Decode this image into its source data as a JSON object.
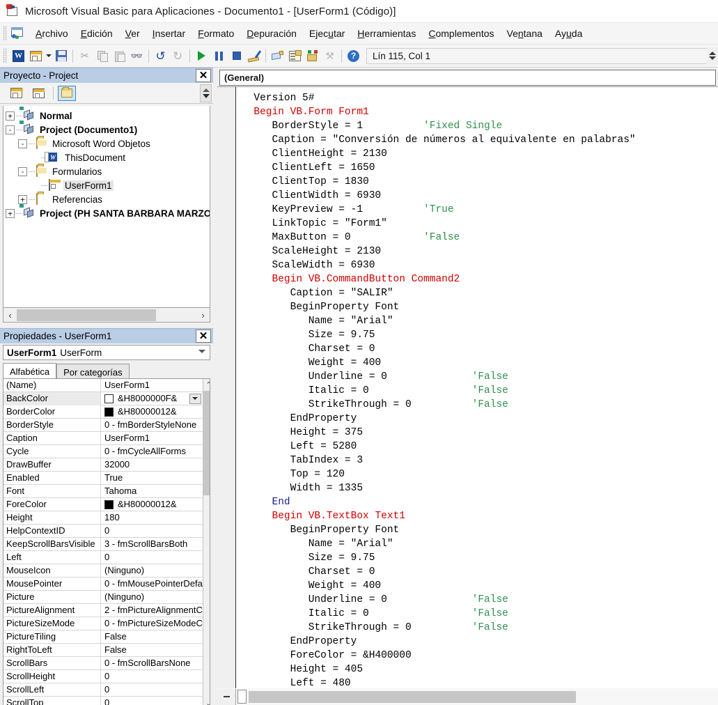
{
  "window": {
    "title": "Microsoft Visual Basic para Aplicaciones - Documento1 - [UserForm1 (Código)]",
    "app_icon": "vba-document-icon"
  },
  "menu": {
    "items": [
      {
        "pre": "",
        "accel": "A",
        "post": "rchivo"
      },
      {
        "pre": "",
        "accel": "E",
        "post": "dición"
      },
      {
        "pre": "",
        "accel": "V",
        "post": "er"
      },
      {
        "pre": "",
        "accel": "I",
        "post": "nsertar"
      },
      {
        "pre": "",
        "accel": "F",
        "post": "ormato"
      },
      {
        "pre": "",
        "accel": "D",
        "post": "epuración"
      },
      {
        "pre": "Ejec",
        "accel": "u",
        "post": "tar"
      },
      {
        "pre": "",
        "accel": "H",
        "post": "erramientas"
      },
      {
        "pre": "",
        "accel": "C",
        "post": "omplementos"
      },
      {
        "pre": "Ve",
        "accel": "n",
        "post": "tana"
      },
      {
        "pre": "Ay",
        "accel": "u",
        "post": "da"
      }
    ]
  },
  "toolbar": {
    "buttons": [
      {
        "name": "view-word-icon",
        "label": "Ver Microsoft Word",
        "enabled": true
      },
      {
        "name": "insert-userform-icon",
        "label": "Insertar UserForm",
        "enabled": true
      },
      {
        "name": "save-icon",
        "label": "Guardar Documento1",
        "enabled": true
      },
      {
        "name": "cut-icon",
        "label": "Cortar",
        "enabled": false
      },
      {
        "name": "copy-icon",
        "label": "Copiar",
        "enabled": false
      },
      {
        "name": "paste-icon",
        "label": "Pegar",
        "enabled": false
      },
      {
        "name": "find-icon",
        "label": "Buscar",
        "enabled": true
      },
      {
        "name": "undo-icon",
        "label": "Deshacer",
        "enabled": true
      },
      {
        "name": "redo-icon",
        "label": "Rehacer",
        "enabled": false
      },
      {
        "name": "run-icon",
        "label": "Ejecutar",
        "enabled": true
      },
      {
        "name": "pause-icon",
        "label": "Interrumpir",
        "enabled": true
      },
      {
        "name": "stop-icon",
        "label": "Restablecer",
        "enabled": true
      },
      {
        "name": "design-mode-icon",
        "label": "Modo de diseño",
        "enabled": true
      },
      {
        "name": "project-explorer-icon",
        "label": "Explorador de proyectos",
        "enabled": true
      },
      {
        "name": "properties-window-icon",
        "label": "Ventana Propiedades",
        "enabled": true
      },
      {
        "name": "object-browser-icon",
        "label": "Examinador de objetos",
        "enabled": true
      },
      {
        "name": "toolbox-icon",
        "label": "Cuadro de herramientas",
        "enabled": false
      },
      {
        "name": "help-icon",
        "label": "Ayuda",
        "enabled": true
      }
    ],
    "status": "Lín 115, Col 1"
  },
  "project_panel": {
    "title": "Proyecto - Project",
    "close_label": "✕",
    "toolbar": [
      {
        "name": "view-code-icon",
        "label": "Ver código",
        "selected": false
      },
      {
        "name": "view-object-icon",
        "label": "Ver objeto",
        "selected": false
      },
      {
        "name": "toggle-folders-icon",
        "label": "Alternar carpetas",
        "selected": true
      }
    ],
    "tree": [
      {
        "label": "Normal",
        "indent": 0,
        "toggle": "+",
        "icon": "vba-project-icon",
        "bold": true,
        "selected": false
      },
      {
        "label": "Project (Documento1)",
        "indent": 0,
        "toggle": "-",
        "icon": "vba-project-icon",
        "bold": true,
        "selected": false
      },
      {
        "label": "Microsoft Word Objetos",
        "indent": 1,
        "toggle": "-",
        "icon": "folder-open-icon",
        "bold": false,
        "selected": false
      },
      {
        "label": "ThisDocument",
        "indent": 2,
        "toggle": "",
        "icon": "word-document-icon",
        "bold": false,
        "selected": false
      },
      {
        "label": "Formularios",
        "indent": 1,
        "toggle": "-",
        "icon": "folder-open-icon",
        "bold": false,
        "selected": false
      },
      {
        "label": "UserForm1",
        "indent": 2,
        "toggle": "",
        "icon": "userform-icon",
        "bold": false,
        "selected": true
      },
      {
        "label": "Referencias",
        "indent": 1,
        "toggle": "+",
        "icon": "folder-icon",
        "bold": false,
        "selected": false
      },
      {
        "label": "Project (PH SANTA BARBARA MARZO",
        "indent": 0,
        "toggle": "+",
        "icon": "vba-project-icon",
        "bold": true,
        "selected": false
      }
    ],
    "scroll_left_arrow": "‹",
    "scroll_right_arrow": "›"
  },
  "properties_panel": {
    "title": "Propiedades - UserForm1",
    "close_label": "✕",
    "object_name": "UserForm1",
    "object_type": "UserForm",
    "tabs": [
      {
        "label": "Alfabética",
        "active": true
      },
      {
        "label": "Por categorías",
        "active": false
      }
    ],
    "rows": [
      {
        "name": "(Name)",
        "value": "UserForm1",
        "swatch": "",
        "dropdown": false,
        "selected": false
      },
      {
        "name": "BackColor",
        "value": "&H8000000F&",
        "swatch": "#ffffff",
        "dropdown": true,
        "selected": true
      },
      {
        "name": "BorderColor",
        "value": "&H80000012&",
        "swatch": "#000000",
        "dropdown": false,
        "selected": false
      },
      {
        "name": "BorderStyle",
        "value": "0 - fmBorderStyleNone",
        "swatch": "",
        "dropdown": false,
        "selected": false
      },
      {
        "name": "Caption",
        "value": "UserForm1",
        "swatch": "",
        "dropdown": false,
        "selected": false
      },
      {
        "name": "Cycle",
        "value": "0 - fmCycleAllForms",
        "swatch": "",
        "dropdown": false,
        "selected": false
      },
      {
        "name": "DrawBuffer",
        "value": "32000",
        "swatch": "",
        "dropdown": false,
        "selected": false
      },
      {
        "name": "Enabled",
        "value": "True",
        "swatch": "",
        "dropdown": false,
        "selected": false
      },
      {
        "name": "Font",
        "value": "Tahoma",
        "swatch": "",
        "dropdown": false,
        "selected": false
      },
      {
        "name": "ForeColor",
        "value": "&H80000012&",
        "swatch": "#000000",
        "dropdown": false,
        "selected": false
      },
      {
        "name": "Height",
        "value": "180",
        "swatch": "",
        "dropdown": false,
        "selected": false
      },
      {
        "name": "HelpContextID",
        "value": "0",
        "swatch": "",
        "dropdown": false,
        "selected": false
      },
      {
        "name": "KeepScrollBarsVisible",
        "value": "3 - fmScrollBarsBoth",
        "swatch": "",
        "dropdown": false,
        "selected": false
      },
      {
        "name": "Left",
        "value": "0",
        "swatch": "",
        "dropdown": false,
        "selected": false
      },
      {
        "name": "MouseIcon",
        "value": "(Ninguno)",
        "swatch": "",
        "dropdown": false,
        "selected": false
      },
      {
        "name": "MousePointer",
        "value": "0 - fmMousePointerDefa",
        "swatch": "",
        "dropdown": false,
        "selected": false
      },
      {
        "name": "Picture",
        "value": "(Ninguno)",
        "swatch": "",
        "dropdown": false,
        "selected": false
      },
      {
        "name": "PictureAlignment",
        "value": "2 - fmPictureAlignmentC",
        "swatch": "",
        "dropdown": false,
        "selected": false
      },
      {
        "name": "PictureSizeMode",
        "value": "0 - fmPictureSizeModeC",
        "swatch": "",
        "dropdown": false,
        "selected": false
      },
      {
        "name": "PictureTiling",
        "value": "False",
        "swatch": "",
        "dropdown": false,
        "selected": false
      },
      {
        "name": "RightToLeft",
        "value": "False",
        "swatch": "",
        "dropdown": false,
        "selected": false
      },
      {
        "name": "ScrollBars",
        "value": "0 - fmScrollBarsNone",
        "swatch": "",
        "dropdown": false,
        "selected": false
      },
      {
        "name": "ScrollHeight",
        "value": "0",
        "swatch": "",
        "dropdown": false,
        "selected": false
      },
      {
        "name": "ScrollLeft",
        "value": "0",
        "swatch": "",
        "dropdown": false,
        "selected": false
      },
      {
        "name": "ScrollTop",
        "value": "0",
        "swatch": "",
        "dropdown": false,
        "selected": false
      }
    ]
  },
  "code_pane": {
    "procedure_selector": "(General)",
    "lines": [
      [
        {
          "t": "  Version 5#",
          "c": ""
        }
      ],
      [
        {
          "t": "  ",
          "c": ""
        },
        {
          "t": "Begin VB.Form Form1",
          "c": "kw"
        }
      ],
      [
        {
          "t": "     BorderStyle = 1          ",
          "c": ""
        },
        {
          "t": "'Fixed Single",
          "c": "cm"
        }
      ],
      [
        {
          "t": "     Caption = \"Conversión de números al equivalente en palabras\"",
          "c": ""
        }
      ],
      [
        {
          "t": "     ClientHeight = 2130",
          "c": ""
        }
      ],
      [
        {
          "t": "     ClientLeft = 1650",
          "c": ""
        }
      ],
      [
        {
          "t": "     ClientTop = 1830",
          "c": ""
        }
      ],
      [
        {
          "t": "     ClientWidth = 6930",
          "c": ""
        }
      ],
      [
        {
          "t": "     KeyPreview = -1          ",
          "c": ""
        },
        {
          "t": "'True",
          "c": "cm"
        }
      ],
      [
        {
          "t": "     LinkTopic = \"Form1\"",
          "c": ""
        }
      ],
      [
        {
          "t": "     MaxButton = 0            ",
          "c": ""
        },
        {
          "t": "'False",
          "c": "cm"
        }
      ],
      [
        {
          "t": "     ScaleHeight = 2130",
          "c": ""
        }
      ],
      [
        {
          "t": "     ScaleWidth = 6930",
          "c": ""
        }
      ],
      [
        {
          "t": "     ",
          "c": ""
        },
        {
          "t": "Begin VB.CommandButton Command2",
          "c": "kw"
        }
      ],
      [
        {
          "t": "        Caption = \"SALIR\"",
          "c": ""
        }
      ],
      [
        {
          "t": "        BeginProperty Font",
          "c": ""
        }
      ],
      [
        {
          "t": "           Name = \"Arial\"",
          "c": ""
        }
      ],
      [
        {
          "t": "           Size = 9.75",
          "c": ""
        }
      ],
      [
        {
          "t": "           Charset = 0",
          "c": ""
        }
      ],
      [
        {
          "t": "           Weight = 400",
          "c": ""
        }
      ],
      [
        {
          "t": "           Underline = 0              ",
          "c": ""
        },
        {
          "t": "'False",
          "c": "cm"
        }
      ],
      [
        {
          "t": "           Italic = 0                 ",
          "c": ""
        },
        {
          "t": "'False",
          "c": "cm"
        }
      ],
      [
        {
          "t": "           StrikeThrough = 0          ",
          "c": ""
        },
        {
          "t": "'False",
          "c": "cm"
        }
      ],
      [
        {
          "t": "        EndProperty",
          "c": ""
        }
      ],
      [
        {
          "t": "        Height = 375",
          "c": ""
        }
      ],
      [
        {
          "t": "        Left = 5280",
          "c": ""
        }
      ],
      [
        {
          "t": "        TabIndex = 3",
          "c": ""
        }
      ],
      [
        {
          "t": "        Top = 120",
          "c": ""
        }
      ],
      [
        {
          "t": "        Width = 1335",
          "c": ""
        }
      ],
      [
        {
          "t": "     ",
          "c": ""
        },
        {
          "t": "End",
          "c": "bl"
        }
      ],
      [
        {
          "t": "     ",
          "c": ""
        },
        {
          "t": "Begin VB.TextBox Text1",
          "c": "kw"
        }
      ],
      [
        {
          "t": "        BeginProperty Font",
          "c": ""
        }
      ],
      [
        {
          "t": "           Name = \"Arial\"",
          "c": ""
        }
      ],
      [
        {
          "t": "           Size = 9.75",
          "c": ""
        }
      ],
      [
        {
          "t": "           Charset = 0",
          "c": ""
        }
      ],
      [
        {
          "t": "           Weight = 400",
          "c": ""
        }
      ],
      [
        {
          "t": "           Underline = 0              ",
          "c": ""
        },
        {
          "t": "'False",
          "c": "cm"
        }
      ],
      [
        {
          "t": "           Italic = 0                 ",
          "c": ""
        },
        {
          "t": "'False",
          "c": "cm"
        }
      ],
      [
        {
          "t": "           StrikeThrough = 0          ",
          "c": ""
        },
        {
          "t": "'False",
          "c": "cm"
        }
      ],
      [
        {
          "t": "        EndProperty",
          "c": ""
        }
      ],
      [
        {
          "t": "        ForeColor = &H400000",
          "c": ""
        }
      ],
      [
        {
          "t": "        Height = 405",
          "c": ""
        }
      ],
      [
        {
          "t": "        Left = 480",
          "c": ""
        }
      ]
    ]
  }
}
